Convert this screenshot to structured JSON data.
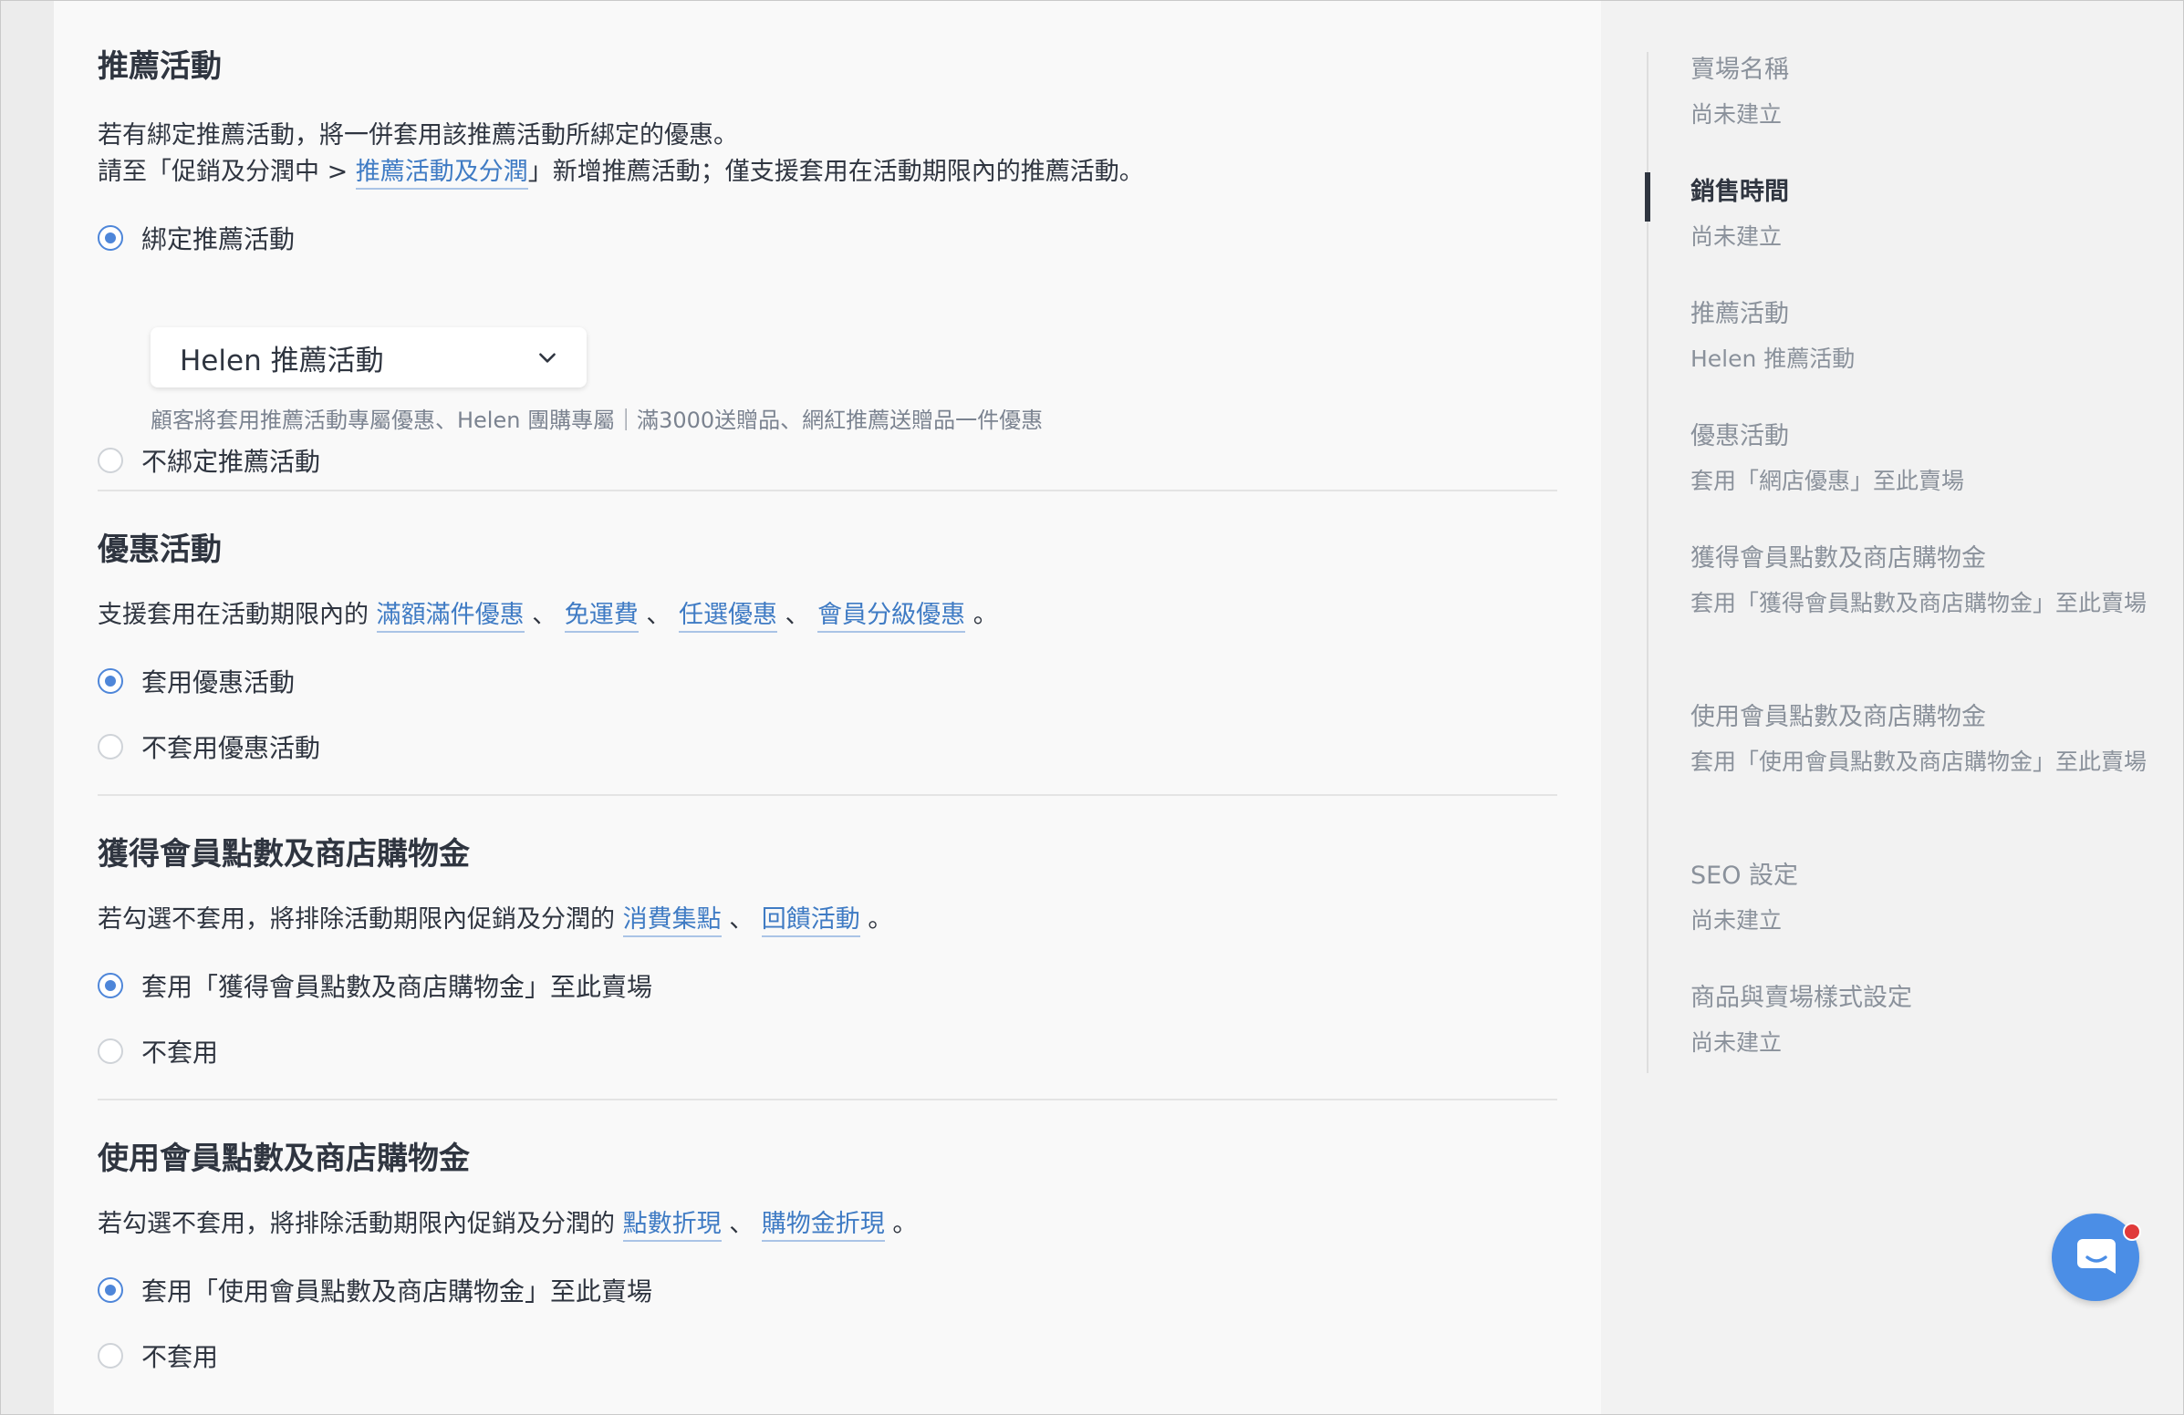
{
  "referral": {
    "title": "推薦活動",
    "desc_line1": "若有綁定推薦活動，將一併套用該推薦活動所綁定的優惠。",
    "desc_line2_prefix": "請至「促銷及分潤中 > ",
    "desc_line2_link": "推薦活動及分潤",
    "desc_line2_suffix": "」新增推薦活動；僅支援套用在活動期限內的推薦活動。",
    "option_bind": "綁定推薦活動",
    "select_value": "Helen 推薦活動",
    "hint": "顧客將套用推薦活動專屬優惠、Helen 團購專屬｜滿3000送贈品、網紅推薦送贈品一件優惠",
    "option_unbind": "不綁定推薦活動"
  },
  "promotion": {
    "title": "優惠活動",
    "desc_prefix": "支援套用在活動期限內的 ",
    "links": [
      "滿額滿件優惠",
      "免運費",
      "任選優惠",
      "會員分級優惠"
    ],
    "separator": "、",
    "desc_suffix": "。",
    "option_apply": "套用優惠活動",
    "option_not_apply": "不套用優惠活動"
  },
  "earn_points": {
    "title": "獲得會員點數及商店購物金",
    "desc_prefix": "若勾選不套用，將排除活動期限內促銷及分潤的 ",
    "links": [
      "消費集點",
      "回饋活動"
    ],
    "separator": "、",
    "desc_suffix": "。",
    "option_apply": "套用「獲得會員點數及商店購物金」至此賣場",
    "option_not_apply": "不套用"
  },
  "use_points": {
    "title": "使用會員點數及商店購物金",
    "desc_prefix": "若勾選不套用，將排除活動期限內促銷及分潤的 ",
    "links": [
      "點數折現",
      "購物金折現"
    ],
    "separator": "、",
    "desc_suffix": "。",
    "option_apply": "套用「使用會員點數及商店購物金」至此賣場",
    "option_not_apply": "不套用"
  },
  "sidebar": {
    "items": [
      {
        "title": "賣場名稱",
        "sub": "尚未建立"
      },
      {
        "title": "銷售時間",
        "sub": "尚未建立"
      },
      {
        "title": "推薦活動",
        "sub": "Helen 推薦活動"
      },
      {
        "title": "優惠活動",
        "sub": "套用「網店優惠」至此賣場"
      },
      {
        "title": "獲得會員點數及商店購物金",
        "sub": "套用「獲得會員點數及商店購物金」至此賣場"
      },
      {
        "title": "使用會員點數及商店購物金",
        "sub": "套用「使用會員點數及商店購物金」至此賣場"
      },
      {
        "title": "SEO 設定",
        "sub": "尚未建立"
      },
      {
        "title": "商品與賣場樣式設定",
        "sub": "尚未建立"
      }
    ],
    "active_index": 1
  },
  "colors": {
    "accent": "#4e86d9",
    "link": "#3f7bc4",
    "chat_button": "#4b8ee6",
    "notification_dot": "#e03a3a"
  },
  "icons": {
    "select_chevron": "chevron-down-icon",
    "chat": "chat-bubble-icon"
  }
}
